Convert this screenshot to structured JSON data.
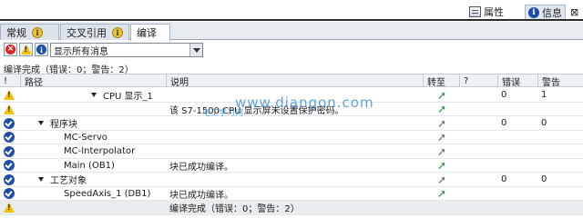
{
  "top_tabs": {
    "properties": "属性",
    "info": "信息",
    "diagnostics_glyph": "⊠"
  },
  "sub_tabs": {
    "general": "常规",
    "cross_ref": "交叉引用",
    "compile": "编译"
  },
  "filter": {
    "selected": "显示所有消息"
  },
  "summary": "编译完成（错误：0；警告：2）",
  "columns": {
    "icon": "!",
    "path": "路径",
    "desc": "说明",
    "goto": "转至",
    "q": "?",
    "errors": "错误",
    "warnings": "警告"
  },
  "rows": [
    {
      "status": "warning",
      "path": "CPU 显示_1",
      "desc": "",
      "goto": "green",
      "errors": "0",
      "warnings": "1"
    },
    {
      "status": "warning",
      "path": "",
      "desc": "该 S7-1500 CPU 显示屏未设置保护密码。",
      "goto": "green",
      "errors": "",
      "warnings": ""
    },
    {
      "status": "ok",
      "path": "程序块",
      "desc": "",
      "goto": "gray",
      "errors": "0",
      "warnings": "0"
    },
    {
      "status": "ok",
      "path": "MC-Servo",
      "desc": "",
      "goto": "gray",
      "errors": "",
      "warnings": ""
    },
    {
      "status": "ok",
      "path": "MC-Interpolator",
      "desc": "",
      "goto": "gray",
      "errors": "",
      "warnings": ""
    },
    {
      "status": "ok",
      "path": "Main (OB1)",
      "desc": "块已成功编译。",
      "goto": "green",
      "errors": "",
      "warnings": ""
    },
    {
      "status": "ok",
      "path": "工艺对象",
      "desc": "",
      "goto": "gray",
      "errors": "0",
      "warnings": "0"
    },
    {
      "status": "ok",
      "path": "SpeedAxis_1 (DB1)",
      "desc": "块已成功编译。",
      "goto": "green",
      "errors": "",
      "warnings": ""
    },
    {
      "status": "warning",
      "path": "",
      "desc": "编译完成（错误：0；警告：2）",
      "goto": "",
      "errors": "",
      "warnings": ""
    }
  ],
  "watermark": {
    "main": "www.diangon.com",
    "sub": "电工学习网"
  },
  "colors": {
    "warning": "#f2c200",
    "ok": "#1d4fa8",
    "goto_green": "#1e9a3a",
    "error": "#d32b1e"
  }
}
